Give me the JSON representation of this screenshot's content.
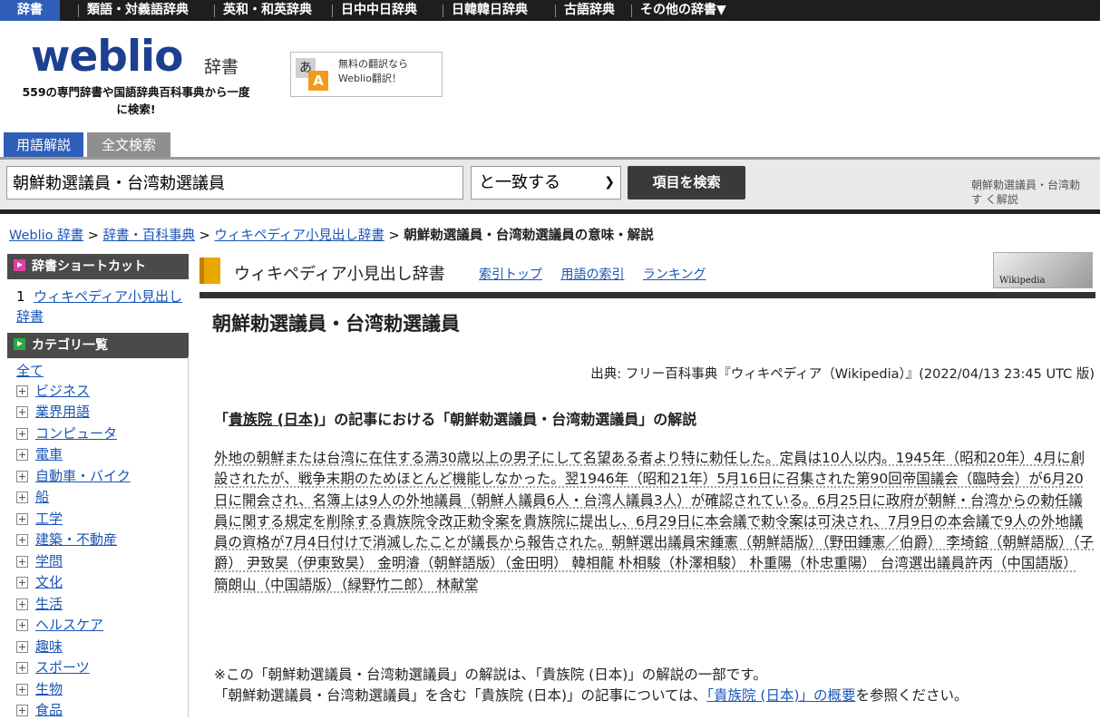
{
  "topnav": {
    "items": [
      "辞書",
      "類語・対義語辞典",
      "英和・和英辞典",
      "日中中日辞典",
      "日韓韓日辞典",
      "古語辞典",
      "その他の辞書▼"
    ]
  },
  "header": {
    "logo_text": "weblio",
    "logo_suffix": "辞書",
    "tagline": "559の専門辞書や国語辞典百科事典から一度に検索!",
    "translate_line1": "無料の翻訳なら",
    "translate_line2": "Weblio翻訳！",
    "translate_icon_a": "あ",
    "translate_icon_b": "A"
  },
  "search": {
    "tab_active": "用語解説",
    "tab_inactive": "全文検索",
    "query": "朝鮮勅選議員・台湾勅選議員",
    "match_option": "と一致する",
    "button_label": "項目を検索",
    "side_text_line1": "朝鮮勅選議員・台湾勅",
    "side_text_line2": "す く解説"
  },
  "breadcrumb": {
    "items": [
      "Weblio 辞書",
      "辞書・百科事典",
      "ウィキペディア小見出し辞書"
    ],
    "current": "朝鮮勅選議員・台湾勅選議員の意味・解説",
    "separator": ">"
  },
  "sidebar": {
    "shortcut_header": "辞書ショートカット",
    "shortcut_index": "1",
    "shortcut_link": "ウィキペディア小見出し辞書",
    "category_header": "カテゴリ一覧",
    "all_label": "全て",
    "categories": [
      "ビジネス",
      "業界用語",
      "コンピュータ",
      "電車",
      "自動車・バイク",
      "船",
      "工学",
      "建築・不動産",
      "学問",
      "文化",
      "生活",
      "ヘルスケア",
      "趣味",
      "スポーツ",
      "生物",
      "食品"
    ]
  },
  "main": {
    "dict_name": "ウィキペディア小見出し辞書",
    "dict_links": [
      "索引トップ",
      "用語の索引",
      "ランキング"
    ],
    "wiki_logo_text": "Wikipedia",
    "title": "朝鮮勅選議員・台湾勅選議員",
    "source": "出典: フリー百科事典『ウィキペディア（Wikipedia）』(2022/04/13 23:45 UTC 版)",
    "subhead_pre": "「",
    "subhead_link": "貴族院 (日本)",
    "subhead_post": "」の記事における「朝鮮勅選議員・台湾勅選議員」の解説",
    "body": "外地の朝鮮または台湾に在住する満30歳以上の男子にして名望ある者より特に勅任した。定員は10人以内。1945年（昭和20年）4月に創設されたが、戦争末期のためほとんど機能しなかった。翌1946年（昭和21年）5月16日に召集された第90回帝国議会（臨時会）が6月20日に開会され、名簿上は9人の外地議員（朝鮮人議員6人・台湾人議員3人）が確認されている。6月25日に政府が朝鮮・台湾からの勅任議員に関する規定を削除する貴族院令改正勅令案を貴族院に提出し、6月29日に本会議で勅令案は可決され、7月9日の本会議で9人の外地議員の資格が7月4日付けで消滅したことが議長から報告された。朝鮮選出議員宋鍾憲（朝鮮語版）（野田鍾憲／伯爵） 李埼鎔（朝鮮語版）（子爵） 尹致昊（伊東致昊） 金明濬（朝鮮語版）（金田明） 韓相龍 朴相駿（朴澤相駿） 朴重陽（朴忠重陽） 台湾選出議員許丙（中国語版） 簡朗山（中国語版）（緑野竹二郎） 林献堂",
    "note_line1": "※この「朝鮮勅選議員・台湾勅選議員」の解説は、「貴族院 (日本)」の解説の一部です。",
    "note_line2_pre": "「朝鮮勅選議員・台湾勅選議員」を含む「貴族院 (日本)」の記事については、",
    "note_line2_link": "「貴族院 (日本)」の概要",
    "note_line2_post": "を参照ください。"
  }
}
